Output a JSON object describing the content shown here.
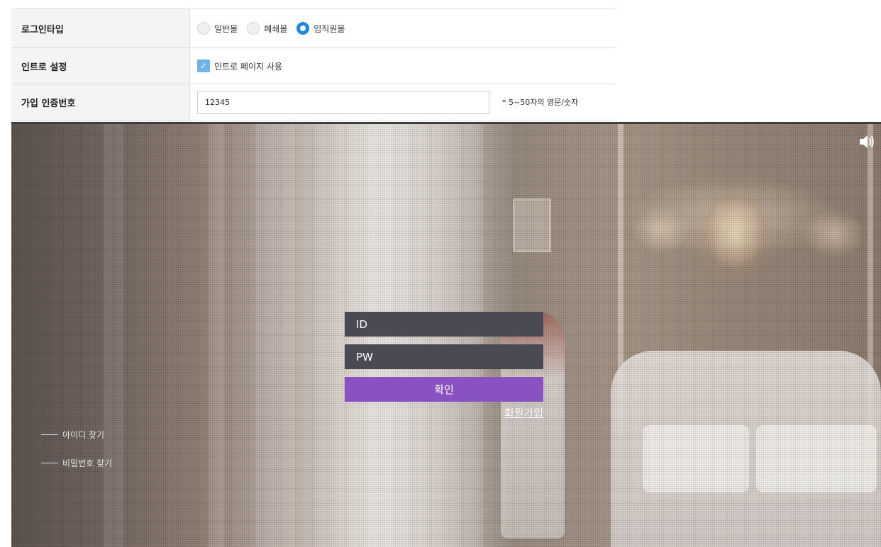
{
  "settings": {
    "login_type": {
      "label": "로그인타입",
      "options": [
        {
          "label": "일반몰",
          "selected": false
        },
        {
          "label": "폐쇄몰",
          "selected": false
        },
        {
          "label": "임직원몰",
          "selected": true
        }
      ]
    },
    "intro": {
      "label": "인트로 설정",
      "checkbox_label": "인트로 페이지 사용",
      "checked": true
    },
    "signup_code": {
      "label": "가입 인증번호",
      "value": "12345",
      "hint": "* 5~50자의 영문/숫자"
    }
  },
  "login_preview": {
    "id_placeholder": "ID",
    "pw_placeholder": "PW",
    "submit_label": "확인",
    "signup_link": "회원가입",
    "find_id": "아이디 찾기",
    "find_pw": "비밀번호 찾기",
    "speaker_icon": "speaker-icon"
  },
  "colors": {
    "radio_selected": "#1e88e5",
    "checkbox": "#6fb3ea",
    "submit_button": "#8a52c0",
    "input_background": "#4a4a54"
  }
}
